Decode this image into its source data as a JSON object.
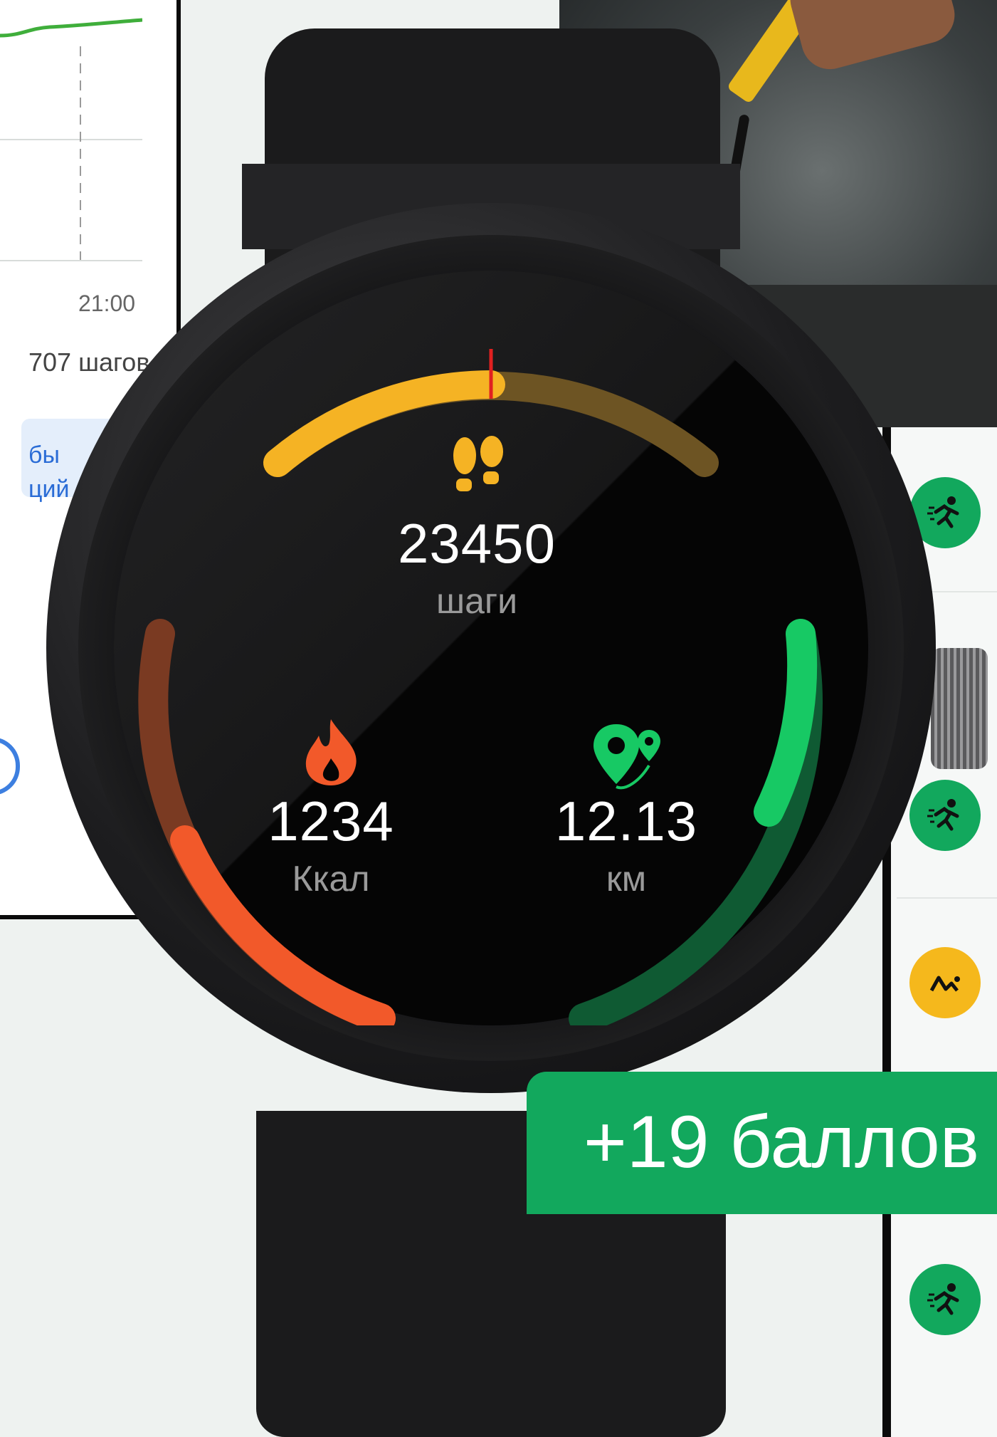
{
  "left_card": {
    "time_label": "21:00",
    "steps_label": "707 шагов",
    "link_line_1": "бы",
    "link_line_2": "ций"
  },
  "watch": {
    "steps_value": "23450",
    "steps_unit": "шаги",
    "calories_value": "1234",
    "calories_unit": "Ккал",
    "distance_value": "12.13",
    "distance_unit": "км"
  },
  "badge": {
    "points_text": "+19 баллов"
  },
  "colors": {
    "steps_arc": "#f5b324",
    "calories_arc": "#f2592a",
    "distance_arc": "#17c964",
    "badge": "#12a85d",
    "list_icon_green": "#12a85d",
    "list_icon_yellow": "#f5b81c"
  },
  "list_icons": [
    "running-icon",
    "running-icon",
    "route-icon",
    "running-icon"
  ]
}
